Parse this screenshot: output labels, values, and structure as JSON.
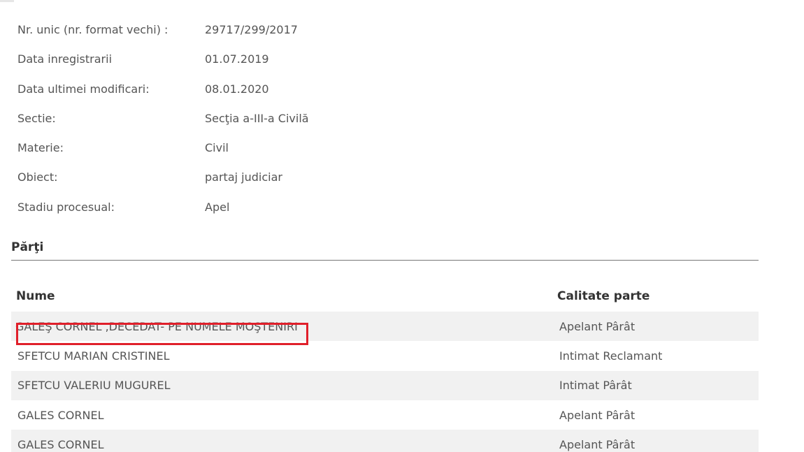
{
  "details": [
    {
      "label": "Nr. unic (nr. format vechi) :",
      "value": "29717/299/2017"
    },
    {
      "label": "Data inregistrarii",
      "value": "01.07.2019"
    },
    {
      "label": "Data ultimei modificari:",
      "value": "08.01.2020"
    },
    {
      "label": "Sectie:",
      "value": "Secţia a-III-a Civilă"
    },
    {
      "label": "Materie:",
      "value": "Civil"
    },
    {
      "label": "Obiect:",
      "value": "partaj judiciar"
    },
    {
      "label": "Stadiu procesual:",
      "value": "Apel"
    }
  ],
  "parties": {
    "title": "Părţi",
    "columns": {
      "name": "Nume",
      "role": "Calitate parte"
    },
    "rows": [
      {
        "name": "GALEŞ CORNEL ,DECEDAT- PE NUMELE MOŞTENIRI",
        "role": "Apelant Pârât"
      },
      {
        "name": "SFETCU MARIAN CRISTINEL",
        "role": "Intimat Reclamant"
      },
      {
        "name": "SFETCU VALERIU MUGUREL",
        "role": "Intimat Pârât"
      },
      {
        "name": "GALES CORNEL",
        "role": "Apelant Pârât"
      },
      {
        "name": "GALES CORNEL",
        "role": "Apelant Pârât"
      }
    ]
  },
  "colors": {
    "highlight": "#e01f2a",
    "row_shade": "#f1f1f1"
  }
}
